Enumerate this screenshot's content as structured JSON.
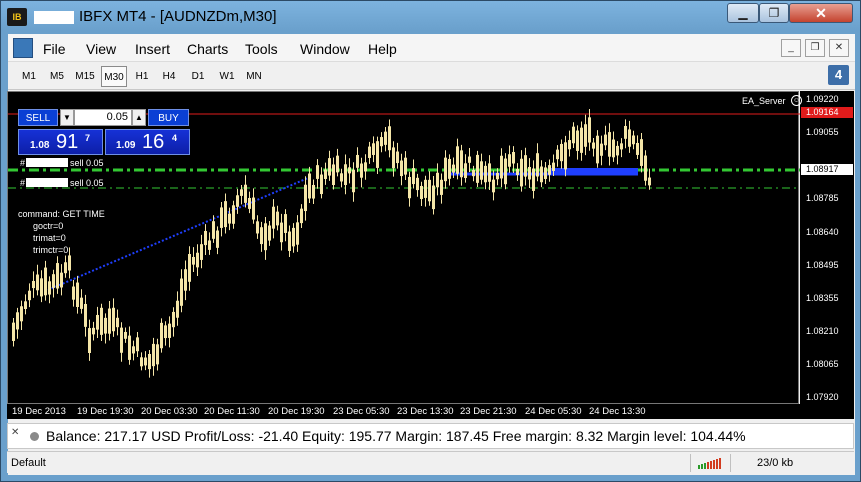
{
  "window": {
    "logo_text": "IB",
    "title": "IBFX MT4 - [AUDNZDm,M30]",
    "minimize_glyph": "▁",
    "maximize_glyph": "❐",
    "close_glyph": "✕"
  },
  "menu": {
    "items": [
      "File",
      "View",
      "Insert",
      "Charts",
      "Tools",
      "Window",
      "Help"
    ],
    "mdi_minimize": "_",
    "mdi_restore": "❐",
    "mdi_close": "✕"
  },
  "timeframes": {
    "items": [
      "M1",
      "M5",
      "M15",
      "M30",
      "H1",
      "H4",
      "D1",
      "W1",
      "MN"
    ],
    "active": "M30",
    "alert_count": "4"
  },
  "one_click": {
    "sell_label": "SELL",
    "buy_label": "BUY",
    "lot_value": "0.05",
    "spin_down": "▼",
    "spin_up": "▲",
    "sell_small": "1.08",
    "sell_big": "91",
    "sell_sup": "7",
    "buy_small": "1.09",
    "buy_big": "16",
    "buy_sup": "4"
  },
  "chart_overlay": {
    "ea_name": "EA_Server",
    "order_lines": [
      "sell 0.05",
      "sell 0.05"
    ],
    "order_prefix_1": "#",
    "order_prefix_2": "#",
    "command_text": "command: GET TIME",
    "vars": [
      "goctr=0",
      "trimat=0",
      "trimctr=0"
    ]
  },
  "price_axis": {
    "labels": [
      "1.09220",
      "1.09055",
      "1.08917",
      "1.08785",
      "1.08640",
      "1.08495",
      "1.08355",
      "1.08210",
      "1.08065",
      "1.07920"
    ],
    "ask_tag": "1.09164",
    "bid_tag": "1.08917"
  },
  "time_axis": {
    "labels": [
      "19 Dec 2013",
      "19 Dec 19:30",
      "20 Dec 03:30",
      "20 Dec 11:30",
      "20 Dec 19:30",
      "23 Dec 05:30",
      "23 Dec 13:30",
      "23 Dec 21:30",
      "24 Dec 05:30",
      "24 Dec 13:30"
    ]
  },
  "colors": {
    "candle": "#f5e6a8",
    "ask_line": "#e01b1b",
    "bid_level": "#33c833",
    "trend_line": "#1f3fff",
    "ask_tag_bg": "#e01b1b",
    "bid_tag_bg": "#ffffff"
  },
  "account": {
    "close_glyph": "✕",
    "summary": "Balance: 217.17 USD  Profit/Loss: -21.40  Equity: 195.77  Margin: 187.45  Free margin: 8.32  Margin level: 104.44%"
  },
  "status": {
    "profile": "Default",
    "traffic": "23/0 kb"
  }
}
